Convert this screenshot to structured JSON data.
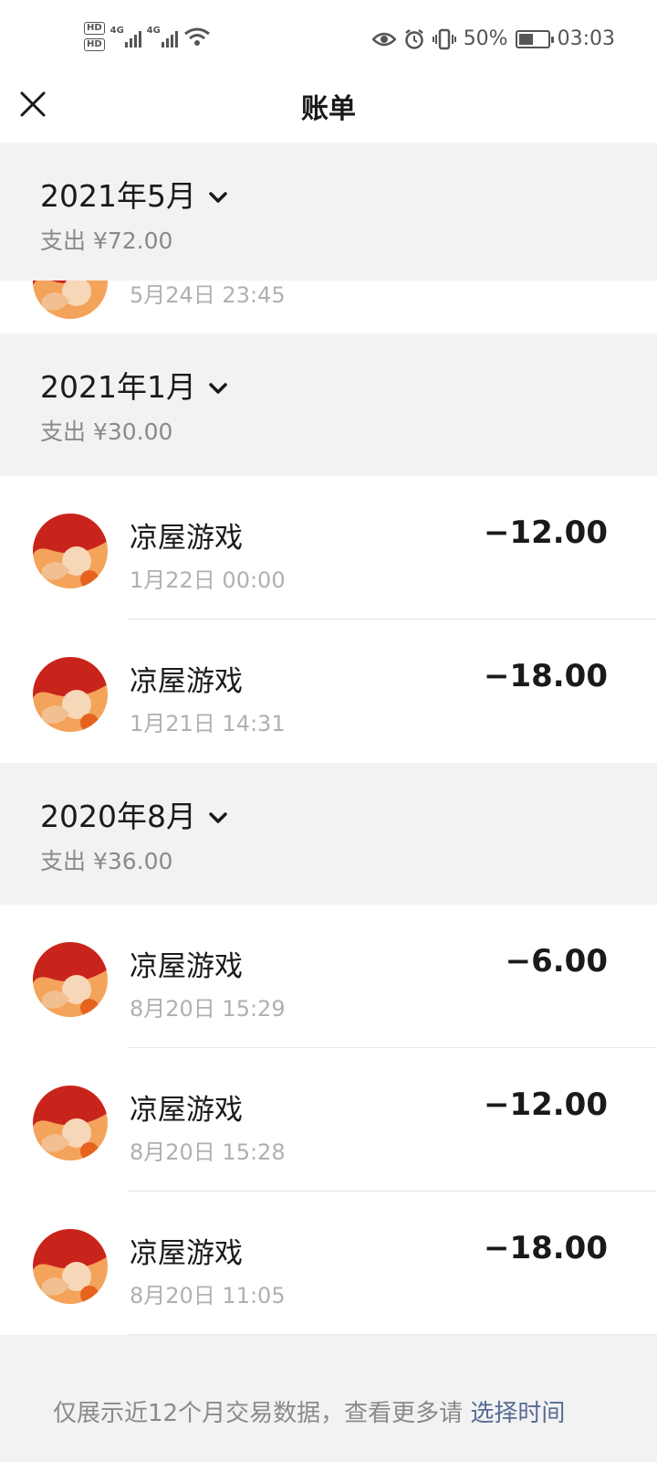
{
  "status_bar": {
    "hd1": "HD",
    "hd2": "HD",
    "net1": "4G",
    "net2": "4G",
    "battery_percent": "50%",
    "battery_level": 0.5,
    "time": "03:03"
  },
  "header": {
    "title": "账单"
  },
  "partial_transaction": {
    "time": "5月24日 23:45"
  },
  "months": [
    {
      "label": "2021年5月",
      "expense": "支出 ¥72.00"
    },
    {
      "label": "2021年1月",
      "expense": "支出 ¥30.00"
    },
    {
      "label": "2020年8月",
      "expense": "支出 ¥36.00"
    }
  ],
  "transactions": [
    {
      "name": "凉屋游戏",
      "time": "1月22日 00:00",
      "amount": "−12.00"
    },
    {
      "name": "凉屋游戏",
      "time": "1月21日 14:31",
      "amount": "−18.00"
    },
    {
      "name": "凉屋游戏",
      "time": "8月20日 15:29",
      "amount": "−6.00"
    },
    {
      "name": "凉屋游戏",
      "time": "8月20日 15:28",
      "amount": "−12.00"
    },
    {
      "name": "凉屋游戏",
      "time": "8月20日 11:05",
      "amount": "−18.00"
    }
  ],
  "footer": {
    "text": "仅展示近12个月交易数据，查看更多请 ",
    "link": "选择时间"
  },
  "colors": {
    "link": "#576b95",
    "secondary_text": "#8a8a8a",
    "background": "#f2f2f2"
  }
}
